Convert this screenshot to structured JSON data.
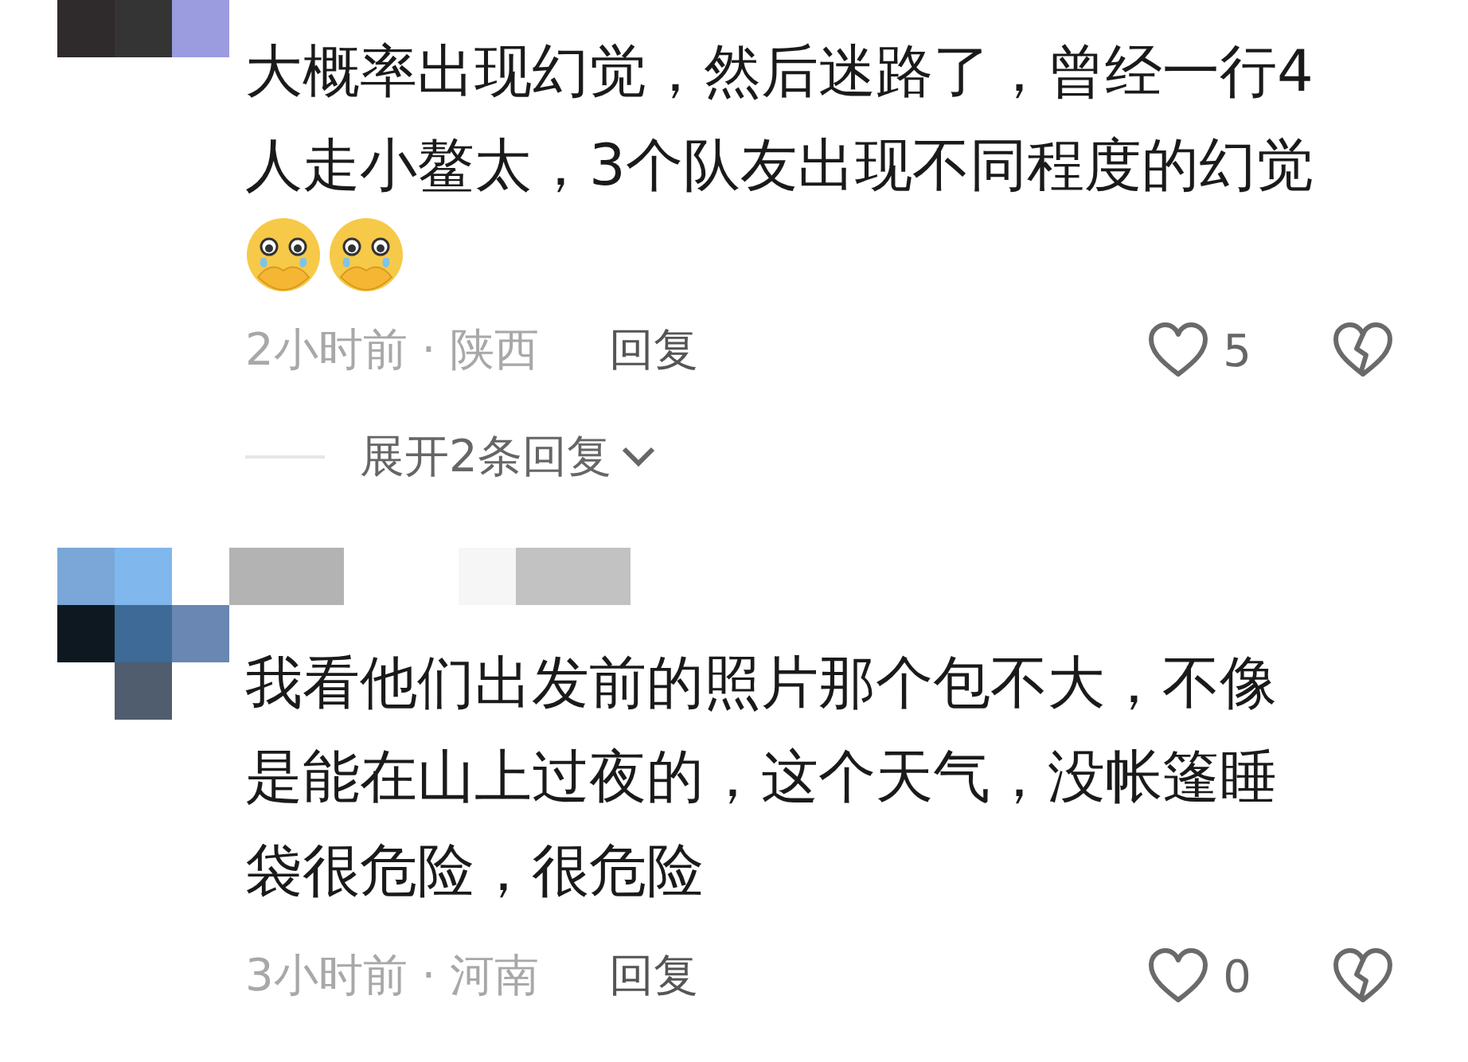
{
  "comments": [
    {
      "name_hidden": false,
      "text": "大概率出现幻觉，然后迷路了，曾经一行4人走小鳌太，3个队友出现不同程度的幻觉",
      "emojis": [
        {
          "kind": "tears"
        },
        {
          "kind": "tears"
        }
      ],
      "time_location": "2小时前 · 陕西",
      "reply": "回复",
      "likes": "5",
      "expand": "展开2条回复"
    },
    {
      "name_hidden": true,
      "text": "我看他们出发前的照片那个包不大，不像是能在山上过夜的，这个天气，没帐篷睡袋很危险，很危险",
      "time_location": "3小时前 · 河南",
      "reply": "回复",
      "likes": "0"
    }
  ]
}
